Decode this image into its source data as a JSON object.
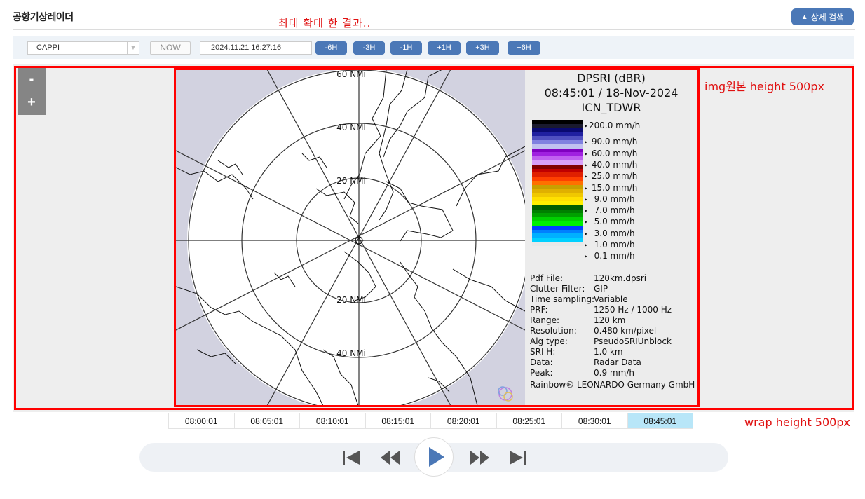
{
  "header": {
    "title": "공항기상레이더",
    "detail_search": "상세 검색",
    "detail_icon": "triangle-up-icon"
  },
  "annotations": {
    "top_note": "최대 확대 한 결과..",
    "img_note": "img원본 height 500px",
    "wrap_note": "wrap height 500px"
  },
  "toolbar": {
    "product_select": "CAPPI",
    "now_label": "NOW",
    "datetime": "2024.11.21 16:27:16",
    "time_buttons": [
      "-6H",
      "-3H",
      "-1H",
      "+1H",
      "+3H",
      "+6H"
    ]
  },
  "zoom": {
    "out_label": "-",
    "in_label": "+"
  },
  "radar": {
    "range_labels": [
      "60 NMi",
      "40 NMi",
      "20 NMi",
      "20 NMi",
      "40 NMi"
    ],
    "legend": {
      "product": "DPSRI (dBR)",
      "datetime": "08:45:01 / 18-Nov-2024",
      "site": "ICN_TDWR",
      "scale_colors": [
        "#000000",
        "#1a1a2e",
        "#0a0a70",
        "#2020a0",
        "#5050c0",
        "#8080e0",
        "#c0c0f0",
        "#8000c0",
        "#a020e0",
        "#c060f0",
        "#d8a0f8",
        "#800000",
        "#c00000",
        "#e02000",
        "#ff4000",
        "#ff7000",
        "#c8a000",
        "#e0b000",
        "#f0c800",
        "#ffe000",
        "#fff000",
        "#006000",
        "#008000",
        "#00a000",
        "#00d000",
        "#00f000",
        "#0040ff",
        "#0080ff",
        "#00b0ff",
        "#00d0ff",
        "#e8e8e8"
      ],
      "scale_labels": [
        "200.0 mm/h",
        " 90.0 mm/h",
        " 60.0 mm/h",
        " 40.0 mm/h",
        " 25.0 mm/h",
        " 15.0 mm/h",
        "  9.0 mm/h",
        "  7.0 mm/h",
        "  5.0 mm/h",
        "  3.0 mm/h",
        "  1.0 mm/h",
        "  0.1 mm/h"
      ],
      "info": [
        {
          "key": "Pdf File:",
          "value": "120km.dpsri"
        },
        {
          "key": "Clutter Filter:",
          "value": "GIP"
        },
        {
          "key": "Time sampling:",
          "value": "Variable"
        },
        {
          "key": "PRF:",
          "value": "1250 Hz / 1000 Hz"
        },
        {
          "key": "Range:",
          "value": "120 km"
        },
        {
          "key": "Resolution:",
          "value": "0.480 km/pixel"
        },
        {
          "key": "Alg type:",
          "value": "PseudoSRIUnblock"
        },
        {
          "key": "SRI H:",
          "value": "1.0 km"
        },
        {
          "key": "Data:",
          "value": "Radar Data"
        },
        {
          "key": "Peak:",
          "value": "0.9 mm/h"
        }
      ],
      "credit": "Rainbow® LEONARDO Germany GmbH"
    }
  },
  "timeline": {
    "times": [
      "08:00:01",
      "08:05:01",
      "08:10:01",
      "08:15:01",
      "08:20:01",
      "08:25:01",
      "08:30:01",
      "08:45:01"
    ],
    "active_index": 7
  },
  "player": {
    "buttons": [
      "first-frame-icon",
      "rewind-icon",
      "play-icon",
      "fast-forward-icon",
      "last-frame-icon"
    ]
  },
  "colors": {
    "accent": "#4b78b7",
    "highlight": "#ff0000",
    "active_time": "#b8e6f8"
  }
}
